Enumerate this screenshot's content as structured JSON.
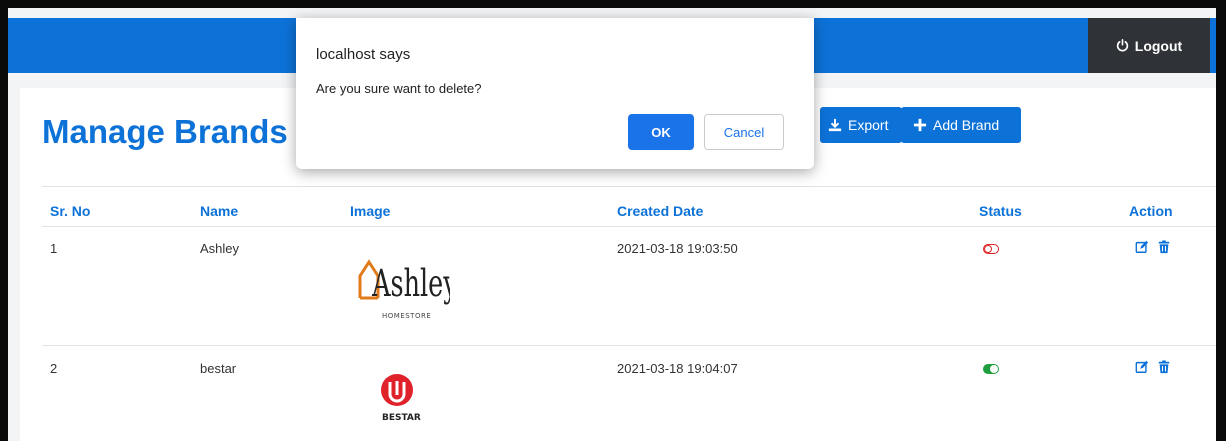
{
  "header": {
    "logout_label": "Logout"
  },
  "page": {
    "title": "Manage Brands",
    "export_label": "Export",
    "add_label": "Add Brand"
  },
  "table": {
    "columns": [
      "Sr. No",
      "Name",
      "Image",
      "Created Date",
      "Status",
      "Action"
    ],
    "rows": [
      {
        "sr": "1",
        "name": "Ashley",
        "logo_text": "Ashley",
        "logo_sub": "HOMESTORE",
        "created": "2021-03-18 19:03:50",
        "status": "inactive"
      },
      {
        "sr": "2",
        "name": "bestar",
        "logo_text": "BESTAR",
        "created": "2021-03-18 19:04:07",
        "status": "active"
      }
    ]
  },
  "dialog": {
    "title": "localhost says",
    "message": "Are you sure want to delete?",
    "ok_label": "OK",
    "cancel_label": "Cancel"
  },
  "colors": {
    "primary": "#0d72d8",
    "dark": "#2f3338",
    "status_off": "#e02424",
    "status_on": "#1e9e3c"
  }
}
